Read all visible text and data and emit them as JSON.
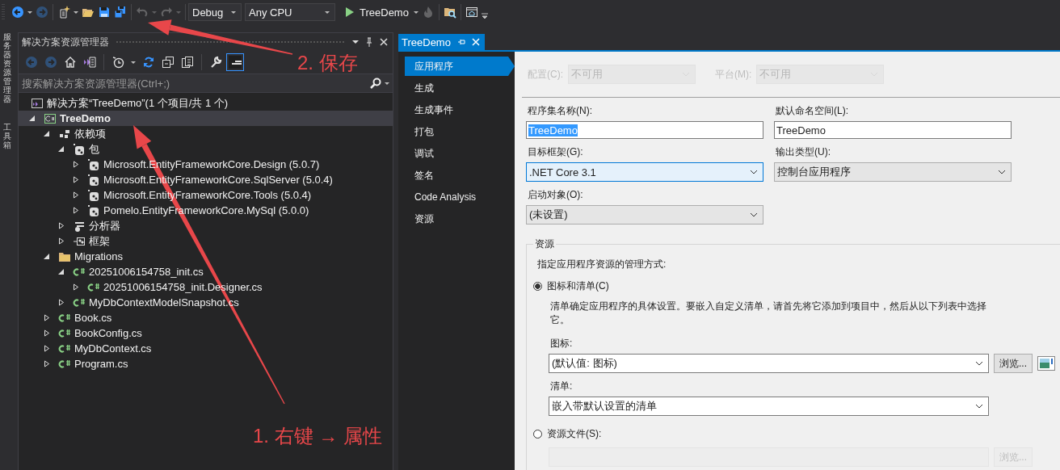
{
  "toolbar": {
    "items": [
      {
        "kind": "back",
        "disabled": false
      },
      {
        "kind": "caret"
      },
      {
        "kind": "forward",
        "disabled": true
      },
      {
        "kind": "separator"
      },
      {
        "kind": "new",
        "disabled": false
      },
      {
        "kind": "caret"
      },
      {
        "kind": "open",
        "disabled": false
      },
      {
        "kind": "save",
        "disabled": false
      },
      {
        "kind": "save_all",
        "disabled": false
      },
      {
        "kind": "separator"
      },
      {
        "kind": "undo",
        "disabled": true
      },
      {
        "kind": "caret"
      },
      {
        "kind": "redo",
        "disabled": true
      },
      {
        "kind": "caret"
      },
      {
        "kind": "separator"
      },
      {
        "kind": "combo",
        "value": "Debug"
      },
      {
        "kind": "combo",
        "value": "Any CPU"
      },
      {
        "kind": "start",
        "label": "TreeDemo"
      },
      {
        "kind": "flame",
        "disabled": true
      },
      {
        "kind": "separator"
      },
      {
        "kind": "folder_search",
        "disabled": false
      },
      {
        "kind": "separator"
      },
      {
        "kind": "window",
        "disabled": false
      }
    ]
  },
  "side_strip": [
    {
      "label": "服务器资源管理器"
    },
    {
      "label": "工具箱"
    }
  ],
  "solution_explorer": {
    "title": "解决方案资源管理器",
    "buttons": [
      {
        "kind": "back",
        "disabled": true,
        "active": false
      },
      {
        "kind": "forward",
        "disabled": true,
        "active": false
      },
      {
        "kind": "home",
        "disabled": false,
        "active": false
      },
      {
        "kind": "switch_views",
        "disabled": false,
        "active": false
      },
      {
        "kind": "separator"
      },
      {
        "kind": "history",
        "disabled": false,
        "active": false
      },
      {
        "kind": "caret"
      },
      {
        "kind": "sync",
        "disabled": false,
        "active": false
      },
      {
        "kind": "collapse",
        "disabled": false,
        "active": false
      },
      {
        "kind": "show_all",
        "disabled": false,
        "active": false
      },
      {
        "kind": "separator"
      },
      {
        "kind": "properties",
        "disabled": false,
        "active": false
      },
      {
        "kind": "preview",
        "disabled": false,
        "active": true
      }
    ],
    "search": {
      "placeholder": "搜索解决方案资源管理器(Ctrl+;)"
    },
    "tree": [
      {
        "label": "解决方案“TreeDemo”(1 个项目/共 1 个)",
        "kind": "solution",
        "selected": false,
        "bold": false,
        "children": [
          {
            "label": "TreeDemo",
            "kind": "project",
            "expanded": true,
            "selected": true,
            "bold": true,
            "children": [
              {
                "label": "依赖项",
                "kind": "dependencies",
                "expanded": true,
                "selected": false,
                "bold": false,
                "children": [
                  {
                    "label": "包",
                    "kind": "package",
                    "expanded": true,
                    "selected": false,
                    "bold": false,
                    "children": [
                      {
                        "label": "Microsoft.EntityFrameworkCore.Design (5.0.7)",
                        "kind": "package",
                        "expanded": false,
                        "selected": false,
                        "bold": false
                      },
                      {
                        "label": "Microsoft.EntityFrameworkCore.SqlServer (5.0.4)",
                        "kind": "package",
                        "expanded": false,
                        "selected": false,
                        "bold": false
                      },
                      {
                        "label": "Microsoft.EntityFrameworkCore.Tools (5.0.4)",
                        "kind": "package",
                        "expanded": false,
                        "selected": false,
                        "bold": false
                      },
                      {
                        "label": "Pomelo.EntityFrameworkCore.MySql (5.0.0)",
                        "kind": "package",
                        "expanded": false,
                        "selected": false,
                        "bold": false
                      }
                    ]
                  },
                  {
                    "label": "分析器",
                    "kind": "analyzer",
                    "expanded": false,
                    "selected": false,
                    "bold": false
                  },
                  {
                    "label": "框架",
                    "kind": "framework",
                    "expanded": false,
                    "selected": false,
                    "bold": false
                  }
                ]
              },
              {
                "label": "Migrations",
                "kind": "folder",
                "expanded": true,
                "selected": false,
                "bold": false,
                "children": [
                  {
                    "label": "20251006154758_init.cs",
                    "kind": "csharp",
                    "expanded": true,
                    "selected": false,
                    "bold": false,
                    "children": [
                      {
                        "label": "20251006154758_init.Designer.cs",
                        "kind": "csharp",
                        "expanded": false,
                        "selected": false,
                        "bold": false
                      }
                    ]
                  },
                  {
                    "label": "MyDbContextModelSnapshot.cs",
                    "kind": "csharp",
                    "expanded": false,
                    "selected": false,
                    "bold": false
                  }
                ]
              },
              {
                "label": "Book.cs",
                "kind": "csharp",
                "expanded": false,
                "selected": false,
                "bold": false
              },
              {
                "label": "BookConfig.cs",
                "kind": "csharp",
                "expanded": false,
                "selected": false,
                "bold": false
              },
              {
                "label": "MyDbContext.cs",
                "kind": "csharp",
                "expanded": false,
                "selected": false,
                "bold": false
              },
              {
                "label": "Program.cs",
                "kind": "csharp",
                "expanded": false,
                "selected": false,
                "bold": false
              }
            ]
          }
        ]
      }
    ]
  },
  "document": {
    "tab": {
      "label": "TreeDemo",
      "selected": true
    },
    "nav": [
      {
        "label": "应用程序",
        "selected": true
      },
      {
        "label": "生成",
        "selected": false
      },
      {
        "label": "生成事件",
        "selected": false
      },
      {
        "label": "打包",
        "selected": false
      },
      {
        "label": "调试",
        "selected": false
      },
      {
        "label": "签名",
        "selected": false
      },
      {
        "label": "Code Analysis",
        "selected": false
      },
      {
        "label": "资源",
        "selected": false
      }
    ],
    "platform_row": [
      {
        "label": "配置(C):",
        "value": "不可用",
        "disabled": true
      },
      {
        "label": "平台(M):",
        "value": "不可用",
        "disabled": true
      }
    ],
    "fields": [
      {
        "kind": "text",
        "label": "程序集名称(N):",
        "value": "TreeDemo",
        "highlighted": true,
        "focused": false
      },
      {
        "kind": "text",
        "label": "默认命名空间(L):",
        "value": "TreeDemo",
        "highlighted": false,
        "focused": false
      },
      {
        "kind": "dropdown",
        "label": "目标框架(G):",
        "value": ".NET Core 3.1",
        "highlighted": false,
        "focused": true
      },
      {
        "kind": "dropdown",
        "label": "输出类型(U):",
        "value": "控制台应用程序",
        "highlighted": false,
        "focused": false
      },
      {
        "kind": "dropdown",
        "label": "启动对象(O):",
        "value": "(未设置)",
        "highlighted": false,
        "focused": false
      }
    ],
    "resources": {
      "title": "资源",
      "description": "指定应用程序资源的管理方式:",
      "options": [
        {
          "label": "图标和清单(C)",
          "selected": true,
          "note": "清单确定应用程序的具体设置。要嵌入自定义清单，请首先将它添加到项目中，然后从以下列表中选择它。",
          "icon_label": "图标:",
          "icon_value": "(默认值: 图标)",
          "browse": "浏览...",
          "manifest_label": "清单:",
          "manifest_value": "嵌入带默认设置的清单"
        },
        {
          "label": "资源文件(S):",
          "selected": false,
          "file_disabled": true,
          "browse": "浏览..."
        }
      ]
    }
  },
  "annotations": [
    {
      "text": "2. 保存"
    },
    {
      "text": "1. 右键 → 属性"
    }
  ]
}
